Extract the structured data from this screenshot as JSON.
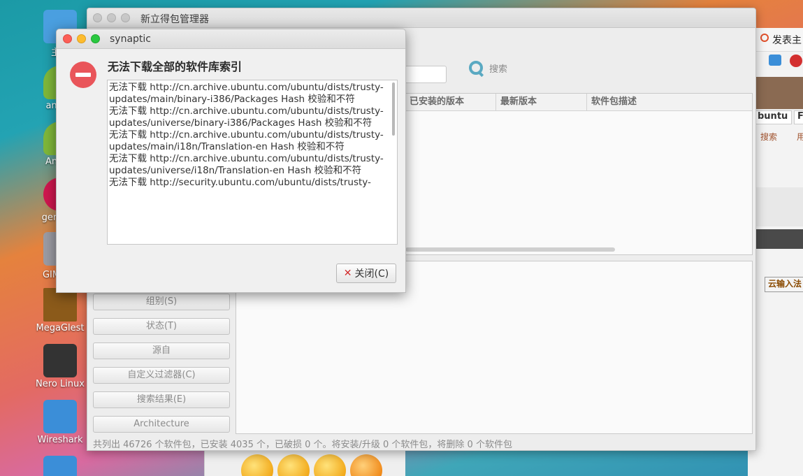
{
  "desktop": {
    "icons": [
      {
        "label": "主文",
        "color": "#4a9fe0"
      },
      {
        "label": "androi",
        "color": "#7fb83a"
      },
      {
        "label": "Androi",
        "color": "#7fb83a"
      },
      {
        "label": "genymo",
        "color": "#d0174f"
      },
      {
        "label": "GIMP 图",
        "color": "#8a8a8a"
      },
      {
        "label": "MegaGlest",
        "color": "#8b5a1a"
      },
      {
        "label": "Nero Linux",
        "color": "#333333"
      },
      {
        "label": "Wireshark",
        "color": "#3b8ed8"
      }
    ]
  },
  "bg_browser": {
    "title_text": "发表主",
    "tab_text": "buntu",
    "tab2_text": "F",
    "link_search": "搜索",
    "link_other": "用",
    "btn_cloud": "云输入法"
  },
  "main_window": {
    "title": "新立得包管理器",
    "search_label": "搜索",
    "columns": [
      "已安装的版本",
      "最新版本",
      "软件包描述"
    ],
    "filters": [
      "组别(S)",
      "状态(T)",
      "源自",
      "自定义过滤器(C)",
      "搜索结果(E)",
      "Architecture"
    ],
    "status": "共列出 46726 个软件包，已安装 4035 个，已破损 0 个。将安装/升级 0 个软件包，将删除 0 个软件包"
  },
  "dialog": {
    "title": "synaptic",
    "heading": "无法下载全部的软件库索引",
    "messages": [
      "无法下载 http://cn.archive.ubuntu.com/ubuntu/dists/trusty-updates/main/binary-i386/Packages  Hash 校验和不符",
      "无法下载 http://cn.archive.ubuntu.com/ubuntu/dists/trusty-updates/universe/binary-i386/Packages  Hash 校验和不符",
      "无法下载 http://cn.archive.ubuntu.com/ubuntu/dists/trusty-updates/main/i18n/Translation-en  Hash 校验和不符",
      "无法下载 http://cn.archive.ubuntu.com/ubuntu/dists/trusty-updates/universe/i18n/Translation-en  Hash 校验和不符",
      "无法下载 http://security.ubuntu.com/ubuntu/dists/trusty-"
    ],
    "close_label": "关闭(C)"
  },
  "colors": {
    "traffic_red": "#fc5f57",
    "traffic_yellow": "#fdbc2e",
    "traffic_green": "#2ac840",
    "error_red": "#e9555a"
  }
}
